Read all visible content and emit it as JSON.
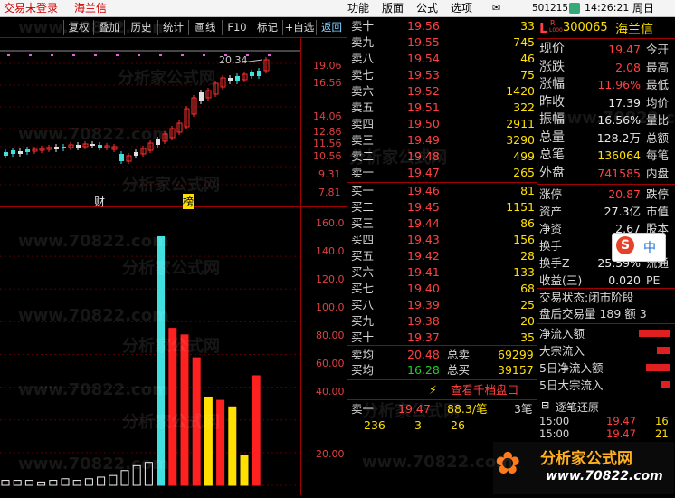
{
  "topbar": {
    "login_status": "交易未登录",
    "stock_name": "海兰信",
    "menus": [
      "功能",
      "版面",
      "公式",
      "选项"
    ],
    "code": "501215",
    "time": "14:26:21",
    "weekday": "周日"
  },
  "toolbar": {
    "buttons": [
      "复权",
      "叠加",
      "历史",
      "统计",
      "画线",
      "F10",
      "标记",
      "+自选",
      "返回"
    ]
  },
  "price_chart": {
    "axis_labels": [
      "19.06",
      "16.56",
      "14.06",
      "12.86",
      "11.56",
      "10.56",
      "9.31",
      "7.81"
    ],
    "high_label": "20.34",
    "event_labels": [
      "财",
      "榜"
    ]
  },
  "volume_chart": {
    "axis_labels": [
      "160.0",
      "140.0",
      "120.0",
      "100.0",
      "80.00",
      "60.00",
      "40.00",
      "20.00"
    ],
    "bars": [
      3,
      3,
      3,
      2,
      3,
      4,
      3,
      4,
      5,
      6,
      9,
      12,
      14,
      152,
      96,
      92,
      78,
      54,
      52,
      48,
      18,
      67
    ],
    "colors": [
      "w",
      "w",
      "w",
      "w",
      "w",
      "w",
      "w",
      "w",
      "w",
      "w",
      "w",
      "w",
      "w",
      "c",
      "r",
      "r",
      "r",
      "y",
      "r",
      "y",
      "y",
      "r"
    ]
  },
  "order_book": {
    "asks": [
      {
        "label": "卖十",
        "price": "19.56",
        "vol": "33"
      },
      {
        "label": "卖九",
        "price": "19.55",
        "vol": "745"
      },
      {
        "label": "卖八",
        "price": "19.54",
        "vol": "46"
      },
      {
        "label": "卖七",
        "price": "19.53",
        "vol": "75"
      },
      {
        "label": "卖六",
        "price": "19.52",
        "vol": "1420"
      },
      {
        "label": "卖五",
        "price": "19.51",
        "vol": "322"
      },
      {
        "label": "卖四",
        "price": "19.50",
        "vol": "2911"
      },
      {
        "label": "卖三",
        "price": "19.49",
        "vol": "3290"
      },
      {
        "label": "卖二",
        "price": "19.48",
        "vol": "499"
      },
      {
        "label": "卖一",
        "price": "19.47",
        "vol": "265"
      }
    ],
    "bids": [
      {
        "label": "买一",
        "price": "19.46",
        "vol": "81"
      },
      {
        "label": "买二",
        "price": "19.45",
        "vol": "1151"
      },
      {
        "label": "买三",
        "price": "19.44",
        "vol": "86"
      },
      {
        "label": "买四",
        "price": "19.43",
        "vol": "156"
      },
      {
        "label": "买五",
        "price": "19.42",
        "vol": "28"
      },
      {
        "label": "买六",
        "price": "19.41",
        "vol": "133"
      },
      {
        "label": "买七",
        "price": "19.40",
        "vol": "68"
      },
      {
        "label": "买八",
        "price": "19.39",
        "vol": "25"
      },
      {
        "label": "买九",
        "price": "19.38",
        "vol": "20"
      },
      {
        "label": "买十",
        "price": "19.37",
        "vol": "35"
      }
    ],
    "avg_sell_label": "卖均",
    "avg_sell": "20.48",
    "total_sell_label": "总卖",
    "total_sell": "69299",
    "avg_buy_label": "买均",
    "avg_buy": "16.28",
    "total_buy_label": "总买",
    "total_buy": "39157",
    "view_thousand": "查看千档盘口",
    "sell1_label": "卖一",
    "sell1_price": "19.47",
    "sell1_per": "88.3/笔",
    "sell1_count": "3笔",
    "sell1_orders": [
      "236",
      "3",
      "26"
    ]
  },
  "info_panel": {
    "code": "300065",
    "name": "海兰信",
    "rows": [
      {
        "label": "现价",
        "value": "19.47",
        "extra": "今开"
      },
      {
        "label": "涨跌",
        "value": "2.08",
        "extra": "最高"
      },
      {
        "label": "涨幅",
        "value": "11.96%",
        "extra": "最低"
      },
      {
        "label": "昨收",
        "value": "17.39",
        "extra": "均价"
      },
      {
        "label": "振幅",
        "value": "16.56%",
        "extra": "量比"
      },
      {
        "label": "总量",
        "value": "128.2万",
        "extra": "总额"
      },
      {
        "label": "总笔",
        "value": "136064",
        "extra": "每笔"
      },
      {
        "label": "外盘",
        "value": "741585",
        "extra": "内盘"
      }
    ],
    "rows2": [
      {
        "label": "涨停",
        "value": "20.87",
        "extra": "跌停"
      },
      {
        "label": "资产",
        "value": "27.3亿",
        "extra": "市值"
      },
      {
        "label": "净资",
        "value": "2.67",
        "extra": "股本"
      },
      {
        "label": "换手",
        "value": "24",
        "extra": ""
      },
      {
        "label": "换手Z",
        "value": "25.59%",
        "extra": "流通"
      },
      {
        "label": "收益(三)",
        "value": "0.020",
        "extra": "PE"
      }
    ],
    "trade_status": "交易状态:闭市阶段",
    "after_hours": "盘后交易量 189 额 3",
    "flows": [
      "净流入额",
      "大宗流入",
      "5日净流入额",
      "5日大宗流入"
    ],
    "tick_title": "逐笔还原",
    "ticks": [
      {
        "time": "15:00",
        "price": "19.47",
        "vol": "16"
      },
      {
        "time": "15:00",
        "price": "19.47",
        "vol": "21"
      }
    ]
  },
  "watermark": {
    "site": "www.70822.com",
    "brand": "分析家公式网",
    "url": "www.70822.com"
  }
}
